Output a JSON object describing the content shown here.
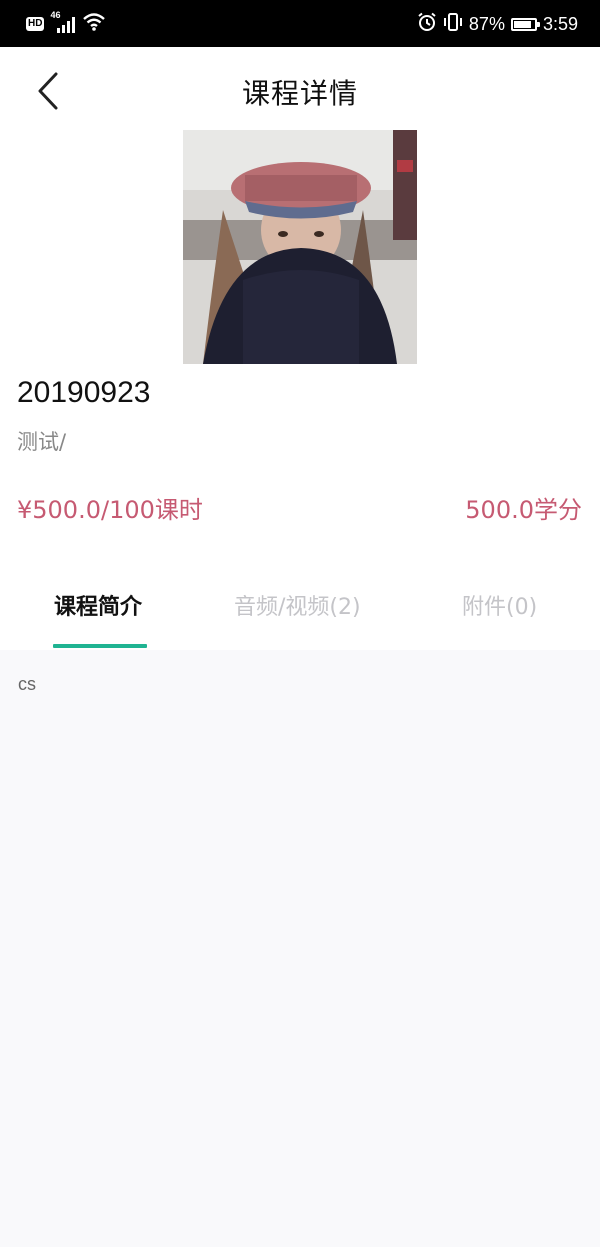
{
  "status_bar": {
    "hd": "HD",
    "network": "46",
    "battery_percent": "87%",
    "battery_level": 0.87,
    "time": "3:59",
    "icons": [
      "signal-icon",
      "wifi-icon",
      "alarm-icon",
      "vibrate-icon",
      "battery-icon"
    ]
  },
  "header": {
    "title": "课程详情",
    "back_icon": "chevron-left-icon"
  },
  "course": {
    "name": "20190923",
    "subtitle": "测试/",
    "price": "¥500.0/100课时",
    "credit": "500.0学分"
  },
  "tabs": [
    {
      "label": "课程简介",
      "active": true
    },
    {
      "label": "音频/视频(2)",
      "active": false
    },
    {
      "label": "附件(0)",
      "active": false
    }
  ],
  "intro": {
    "text": "cs"
  },
  "colors": {
    "accent": "#1fb492",
    "price": "#c65a72",
    "inactive_tab": "#c4c4c8",
    "background": "#f9f9fb"
  }
}
